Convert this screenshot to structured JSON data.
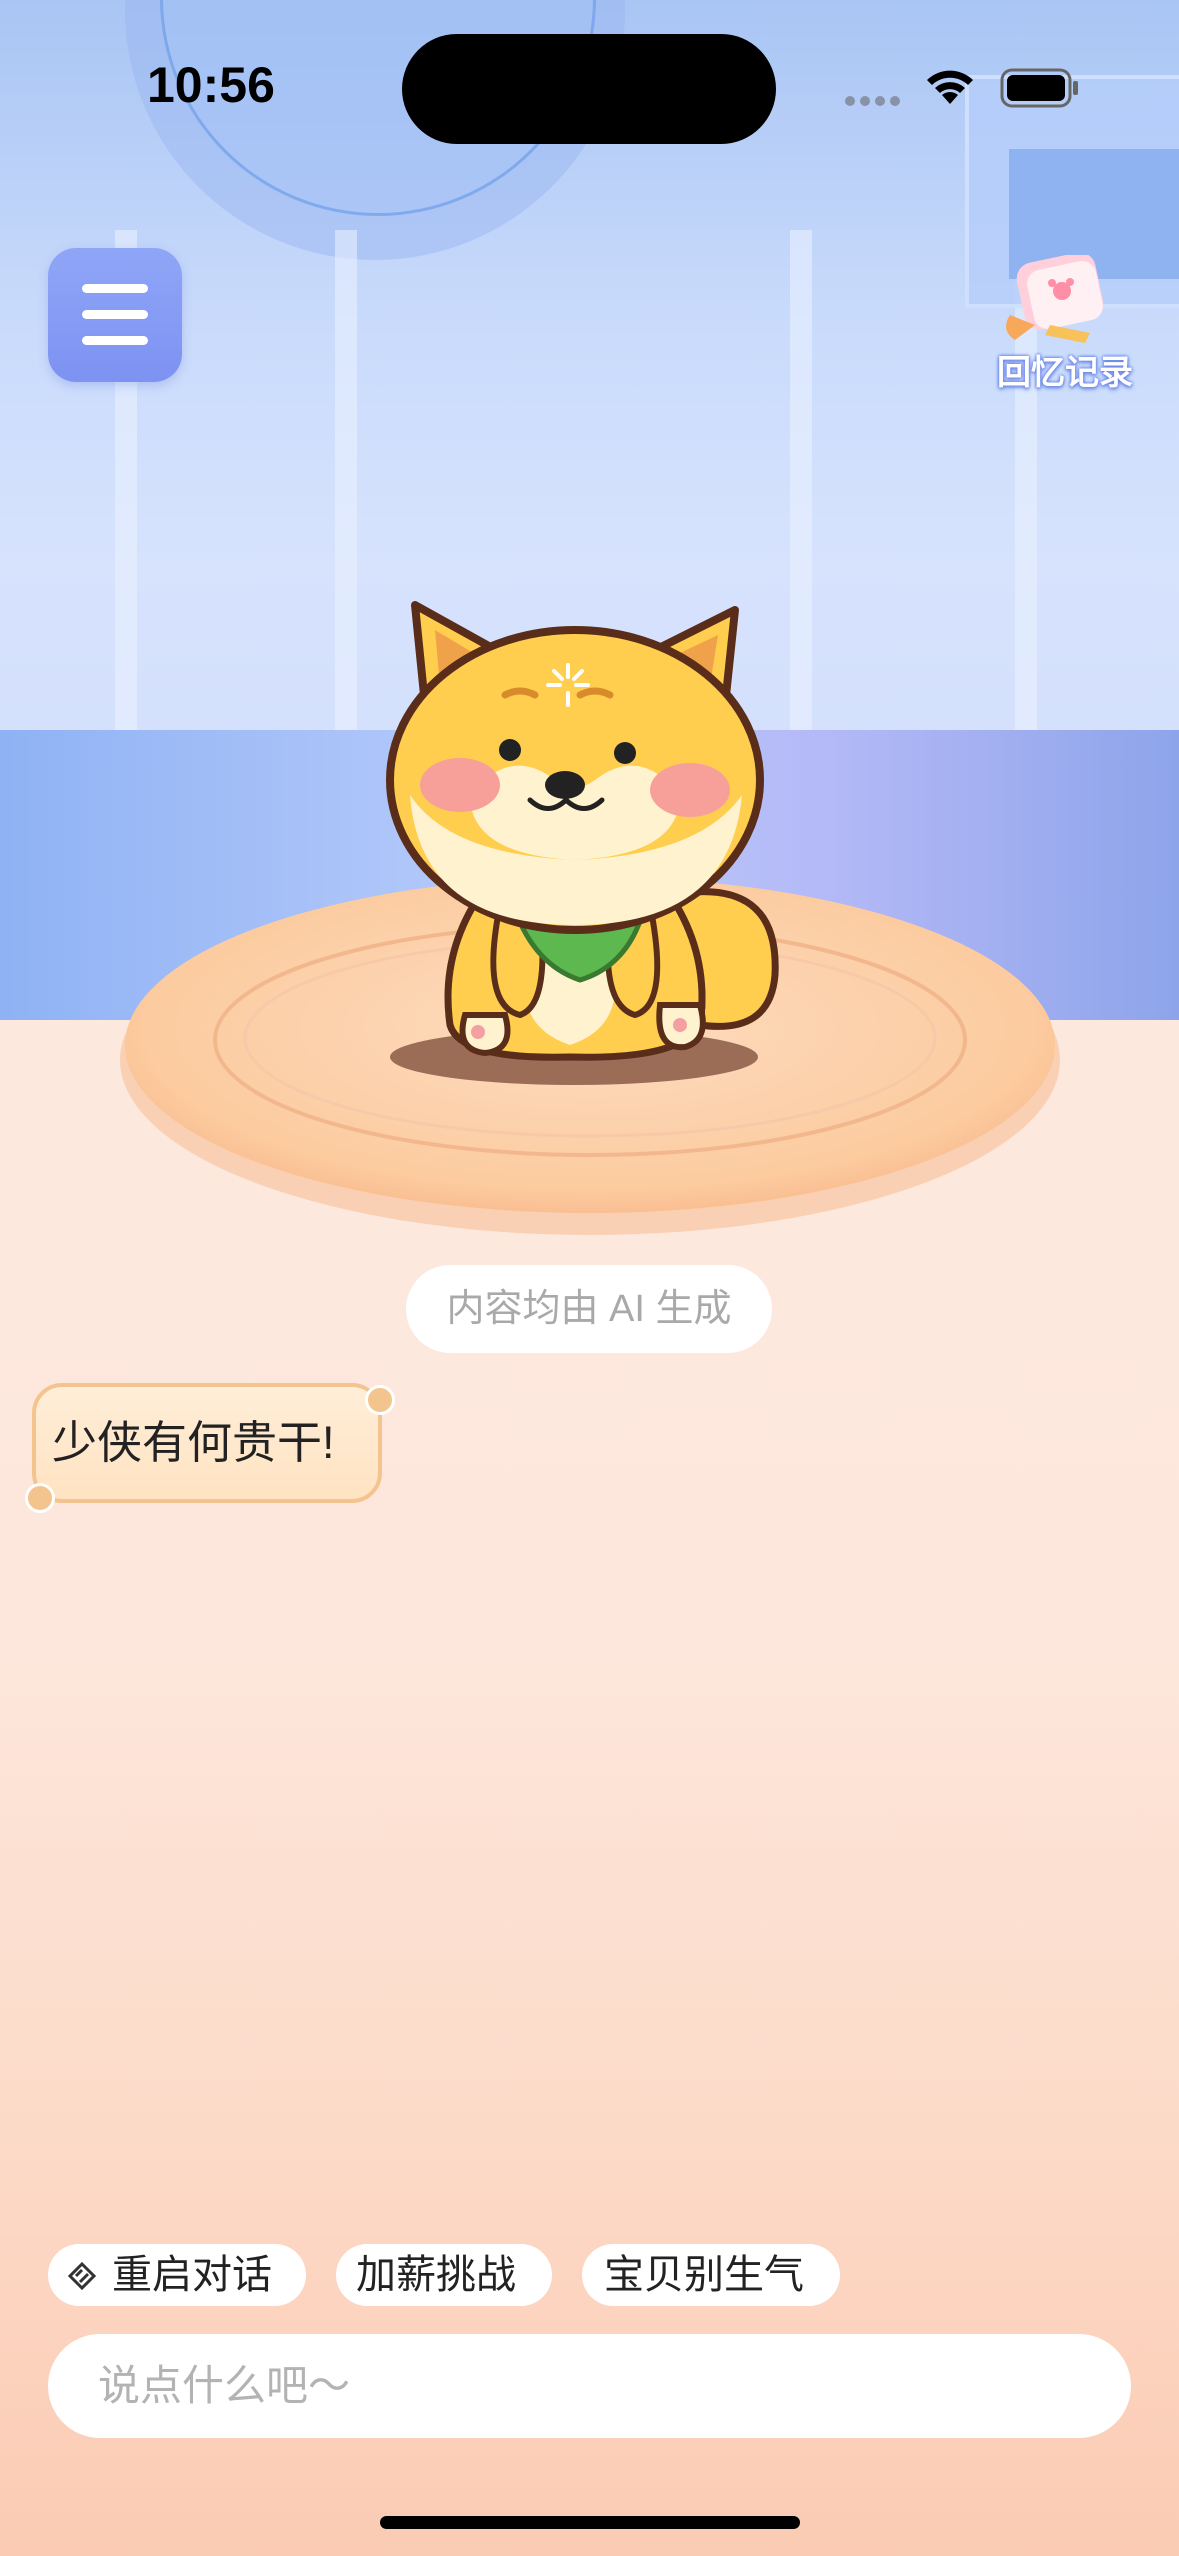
{
  "status_bar": {
    "time": "10:56"
  },
  "header": {
    "memory_label": "回忆记录"
  },
  "ai_notice": "内容均由 AI 生成",
  "chat": {
    "bubble_text": "少侠有何贵干!"
  },
  "quick_actions": [
    {
      "label": "重启对话",
      "icon": "restart-icon"
    },
    {
      "label": "加薪挑战"
    },
    {
      "label": "宝贝别生气"
    }
  ],
  "input": {
    "placeholder": "说点什么吧～"
  },
  "colors": {
    "menu_button": "#8a9ff5",
    "bubble_border": "#f4c48f",
    "floor": "#fde0cf"
  }
}
